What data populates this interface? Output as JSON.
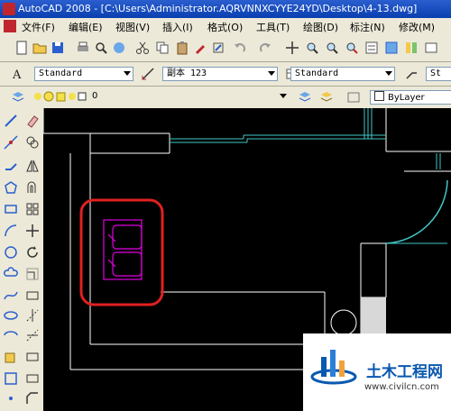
{
  "window": {
    "title": "AutoCAD 2008 - [C:\\Users\\Administrator.AQRVNNXCYYE24YD\\Desktop\\4-13.dwg]"
  },
  "menu": {
    "items": [
      "文件(F)",
      "编辑(E)",
      "视图(V)",
      "插入(I)",
      "格式(O)",
      "工具(T)",
      "绘图(D)",
      "标注(N)",
      "修改(M)"
    ]
  },
  "styles_toolbar": {
    "text_style": "Standard",
    "dim_style": "副本 123",
    "table_style": "Standard",
    "multileader_style": "St"
  },
  "layers_toolbar": {
    "layer": "0",
    "color": "ByLayer"
  },
  "watermark": {
    "title": "土木工程网",
    "url": "www.civilcn.com"
  },
  "colors": {
    "canvas": "#000000",
    "walls": "#ffffff",
    "cyan_lines": "#40c8c8",
    "magenta_block": "#e000e0",
    "highlight": "#e02020"
  }
}
